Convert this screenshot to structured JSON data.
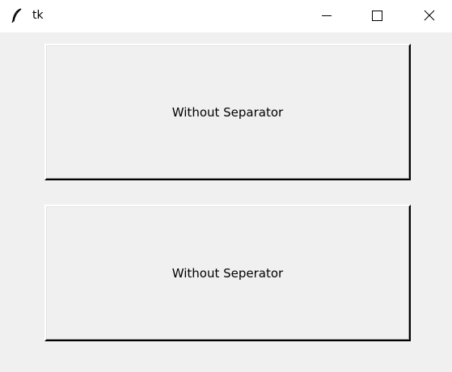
{
  "window": {
    "title": "tk",
    "icon": "tk-feather-icon",
    "controls": {
      "minimize_icon": "minimize-icon",
      "maximize_icon": "maximize-icon",
      "close_icon": "close-icon"
    }
  },
  "buttons": [
    {
      "label": "Without Separator"
    },
    {
      "label": "Without Seperator"
    }
  ],
  "colors": {
    "titlebar": "#ffffff",
    "background": "#f0f0f0",
    "text": "#000000"
  }
}
